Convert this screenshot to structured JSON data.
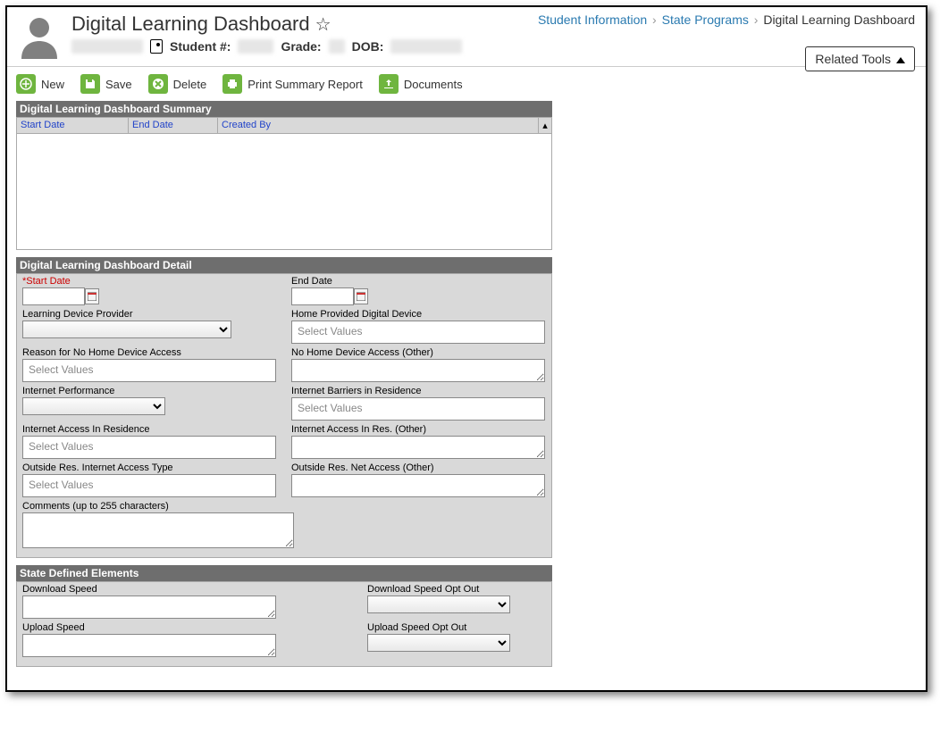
{
  "header": {
    "title": "Digital Learning Dashboard",
    "student_num_label": "Student #:",
    "grade_label": "Grade:",
    "dob_label": "DOB:",
    "related_tools": "Related Tools"
  },
  "breadcrumb": {
    "a": "Student Information",
    "b": "State Programs",
    "c": "Digital Learning Dashboard"
  },
  "toolbar": {
    "new": "New",
    "save": "Save",
    "delete": "Delete",
    "print": "Print Summary Report",
    "documents": "Documents"
  },
  "summary": {
    "title": "Digital Learning Dashboard Summary",
    "cols": {
      "start": "Start Date",
      "end": "End Date",
      "created": "Created By"
    }
  },
  "detail": {
    "title": "Digital Learning Dashboard Detail",
    "start_date": "*Start Date",
    "end_date": "End Date",
    "learning_device_provider": "Learning Device Provider",
    "home_device": "Home Provided Digital Device",
    "reason_no_home": "Reason for No Home Device Access",
    "no_home_other": "No Home Device Access (Other)",
    "internet_perf": "Internet Performance",
    "internet_barriers": "Internet Barriers in Residence",
    "internet_access_res": "Internet Access In Residence",
    "internet_access_res_other": "Internet Access In Res. (Other)",
    "outside_type": "Outside Res. Internet Access Type",
    "outside_other": "Outside Res. Net Access (Other)",
    "comments": "Comments (up to 255 characters)",
    "select_values": "Select Values"
  },
  "state": {
    "title": "State Defined Elements",
    "dl_speed": "Download Speed",
    "dl_opt": "Download Speed Opt Out",
    "ul_speed": "Upload Speed",
    "ul_opt": "Upload Speed Opt Out"
  }
}
